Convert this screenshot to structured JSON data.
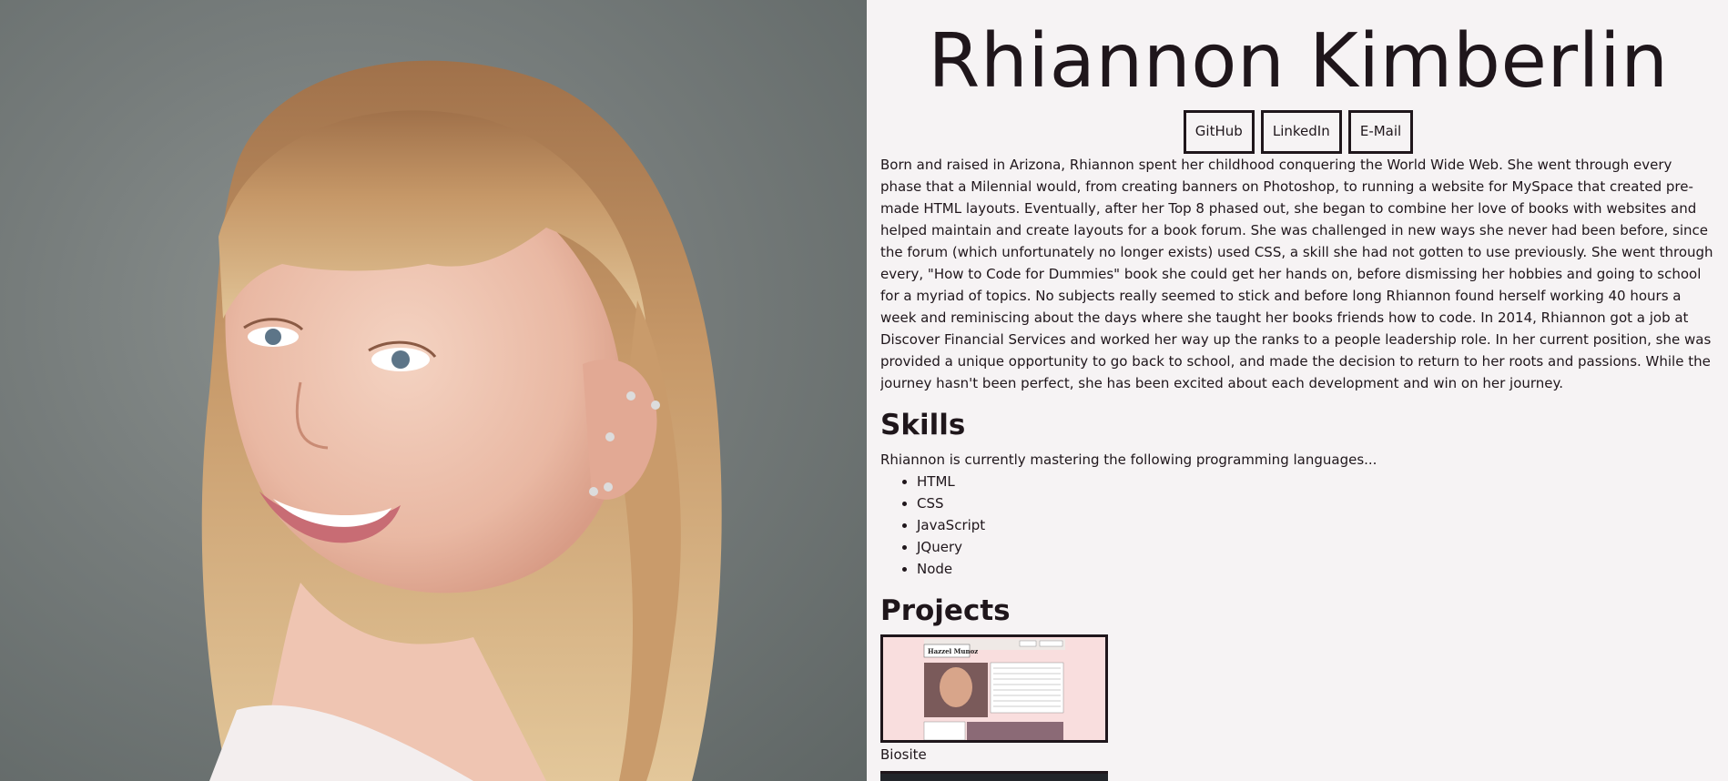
{
  "header": {
    "name": "Rhiannon Kimberlin",
    "links": [
      {
        "label": "GitHub"
      },
      {
        "label": "LinkedIn"
      },
      {
        "label": "E-Mail"
      }
    ]
  },
  "about": {
    "bio": "Born and raised in Arizona, Rhiannon spent her childhood conquering the World Wide Web. She went through every phase that a Milennial would, from creating banners on Photoshop, to running a website for MySpace that created pre-made HTML layouts. Eventually, after her Top 8 phased out, she began to combine her love of books with websites and helped maintain and create layouts for a book forum. She was challenged in new ways she never had been before, since the forum (which unfortunately no longer exists) used CSS, a skill she had not gotten to use previously. She went through every, \"How to Code for Dummies\" book she could get her hands on, before dismissing her hobbies and going to school for a myriad of topics. No subjects really seemed to stick and before long Rhiannon found herself working 40 hours a week and reminiscing about the days where she taught her books friends how to code. In 2014, Rhiannon got a job at Discover Financial Services and worked her way up the ranks to a people leadership role. In her current position, she was provided a unique opportunity to go back to school, and made the decision to return to her roots and passions. While the journey hasn't been perfect, she has been excited about each development and win on her journey."
  },
  "skills": {
    "heading": "Skills",
    "intro": "Rhiannon is currently mastering the following programming languages...",
    "items": [
      "HTML",
      "CSS",
      "JavaScript",
      "JQuery",
      "Node"
    ]
  },
  "projects": {
    "heading": "Projects",
    "items": [
      {
        "caption": "Biosite",
        "thumb_title": "Hazzel Munoz"
      }
    ]
  },
  "colors": {
    "background": "#f6f3f4",
    "text": "#1f161b",
    "thumb_bg": "#f9dede"
  }
}
